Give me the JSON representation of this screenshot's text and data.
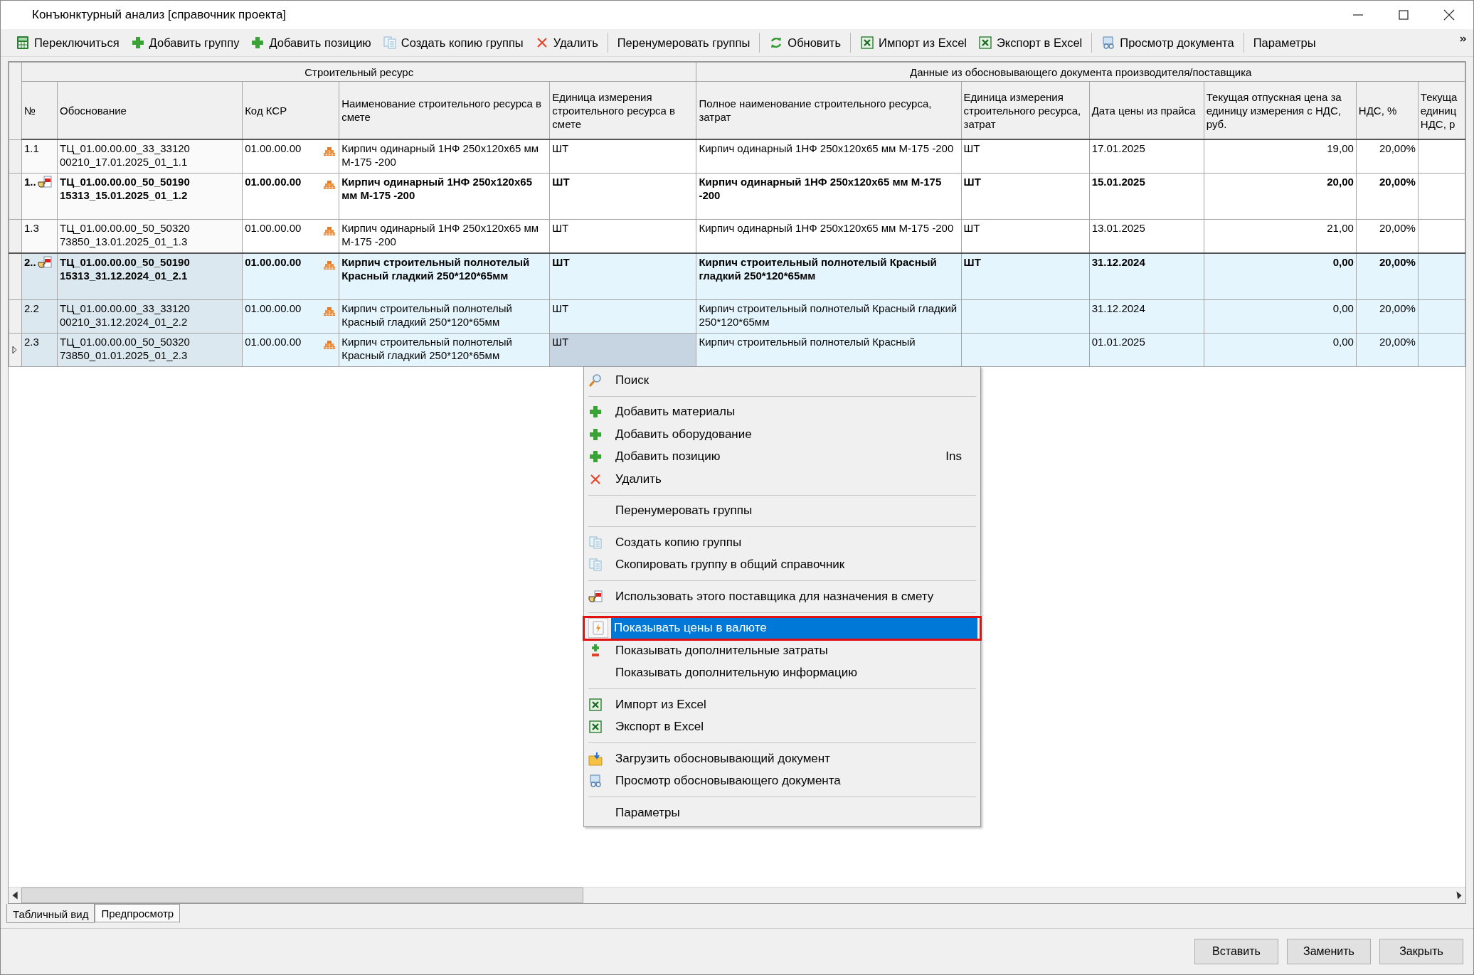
{
  "window": {
    "title": "Конъюнктурный анализ [справочник проекта]"
  },
  "toolbar": {
    "items": [
      {
        "label": "Переключиться"
      },
      {
        "label": "Добавить группу"
      },
      {
        "label": "Добавить позицию"
      },
      {
        "label": "Создать копию группы"
      },
      {
        "label": "Удалить"
      },
      {
        "label": "Перенумеровать группы"
      },
      {
        "label": "Обновить"
      },
      {
        "label": "Импорт из Excel"
      },
      {
        "label": "Экспорт в Excel"
      },
      {
        "label": "Просмотр документа"
      },
      {
        "label": "Параметры"
      }
    ]
  },
  "table": {
    "column_groups": [
      {
        "label": "Строительный ресурс"
      },
      {
        "label": "Данные из обосновывающего документа производителя/поставщика"
      }
    ],
    "columns": [
      {
        "label": "№"
      },
      {
        "label": "Обоснование"
      },
      {
        "label": "Код КСР"
      },
      {
        "label": "Наименование строительного ресурса в смете"
      },
      {
        "label": "Единица измерения строительного ресурса в смете"
      },
      {
        "label": "Полное наименование строительного ресурса, затрат"
      },
      {
        "label": "Единица измерения строительного ресурса, затрат"
      },
      {
        "label": "Дата цены из прайса"
      },
      {
        "label": "Текущая отпускная цена за единицу измерения с НДС, руб."
      },
      {
        "label": "НДС, %"
      },
      {
        "label": "Текуща единиц НДС, р"
      }
    ],
    "rows": [
      {
        "kind": "item",
        "selected": false,
        "current": false,
        "unit_focused": false,
        "cells": [
          "1.1",
          "ТЦ_01.00.00.00_33_33120 00210_17.01.2025_01_1.1",
          "01.00.00.00",
          "Кирпич одинарный 1НФ 250x120x65 мм М-175 -200",
          "ШТ",
          "Кирпич одинарный 1НФ 250x120x65 мм М-175 -200",
          "ШТ",
          "17.01.2025",
          "19,00",
          "20,00%"
        ]
      },
      {
        "kind": "group",
        "selected": false,
        "current": false,
        "unit_focused": false,
        "cells": [
          "1..",
          "ТЦ_01.00.00.00_50_50190 15313_15.01.2025_01_1.2",
          "01.00.00.00",
          "Кирпич одинарный 1НФ 250x120x65 мм М-175 -200",
          "ШТ",
          "Кирпич одинарный 1НФ 250x120x65 мм М-175 -200",
          "ШТ",
          "15.01.2025",
          "20,00",
          "20,00%"
        ]
      },
      {
        "kind": "item",
        "selected": false,
        "current": false,
        "unit_focused": false,
        "cells": [
          "1.3",
          "ТЦ_01.00.00.00_50_50320 73850_13.01.2025_01_1.3",
          "01.00.00.00",
          "Кирпич одинарный 1НФ 250x120x65 мм М-175 -200",
          "ШТ",
          "Кирпич одинарный 1НФ 250x120x65 мм М-175 -200",
          "ШТ",
          "13.01.2025",
          "21,00",
          "20,00%"
        ]
      },
      {
        "kind": "group",
        "selected": true,
        "current": false,
        "unit_focused": false,
        "cells": [
          "2..",
          "ТЦ_01.00.00.00_50_50190 15313_31.12.2024_01_2.1",
          "01.00.00.00",
          "Кирпич строительный полнотелый Красный гладкий 250*120*65мм",
          "ШТ",
          "Кирпич строительный полнотелый Красный гладкий 250*120*65мм",
          "ШТ",
          "31.12.2024",
          "0,00",
          "20,00%"
        ]
      },
      {
        "kind": "item",
        "selected": true,
        "current": false,
        "unit_focused": false,
        "cells": [
          "2.2",
          "ТЦ_01.00.00.00_33_33120 00210_31.12.2024_01_2.2",
          "01.00.00.00",
          "Кирпич строительный полнотелый Красный гладкий 250*120*65мм",
          "ШТ",
          "Кирпич строительный полнотелый Красный гладкий 250*120*65мм",
          "",
          "31.12.2024",
          "0,00",
          "20,00%"
        ]
      },
      {
        "kind": "item",
        "selected": true,
        "current": true,
        "unit_focused": true,
        "cells": [
          "2.3",
          "ТЦ_01.00.00.00_50_50320 73850_01.01.2025_01_2.3",
          "01.00.00.00",
          "Кирпич строительный полнотелый Красный гладкий 250*120*65мм",
          "ШТ",
          "Кирпич строительный полнотелый Красный",
          "",
          "01.01.2025",
          "0,00",
          "20,00%"
        ]
      }
    ]
  },
  "context_menu": {
    "items": [
      {
        "label": "Поиск",
        "selected": false,
        "highlighted": false
      },
      {
        "label": "Добавить материалы",
        "selected": false,
        "highlighted": false
      },
      {
        "label": "Добавить оборудование",
        "selected": false,
        "highlighted": false
      },
      {
        "label": "Добавить позицию",
        "shortcut": "Ins",
        "selected": false,
        "highlighted": false
      },
      {
        "label": "Удалить",
        "selected": false,
        "highlighted": false
      },
      {
        "label": "Перенумеровать группы",
        "selected": false,
        "highlighted": false
      },
      {
        "label": "Создать копию группы",
        "selected": false,
        "highlighted": false
      },
      {
        "label": "Скопировать группу в общий справочник",
        "selected": false,
        "highlighted": false
      },
      {
        "label": "Использовать этого поставщика для назначения в смету",
        "selected": false,
        "highlighted": false
      },
      {
        "label": "Показывать цены в валюте",
        "selected": true,
        "highlighted": true
      },
      {
        "label": "Показывать дополнительные затраты",
        "selected": false,
        "highlighted": false
      },
      {
        "label": "Показывать дополнительную информацию",
        "selected": false,
        "highlighted": false
      },
      {
        "label": "Импорт из Excel",
        "selected": false,
        "highlighted": false
      },
      {
        "label": "Экспорт в Excel",
        "selected": false,
        "highlighted": false
      },
      {
        "label": "Загрузить обосновывающий документ",
        "selected": false,
        "highlighted": false
      },
      {
        "label": "Просмотр обосновывающего документа",
        "selected": false,
        "highlighted": false
      },
      {
        "label": "Параметры",
        "selected": false,
        "highlighted": false
      }
    ]
  },
  "view_tabs": [
    {
      "label": "Табличный вид",
      "selected": true
    },
    {
      "label": "Предпросмотр",
      "selected": false
    }
  ],
  "buttons": [
    "Вставить",
    "Заменить",
    "Закрыть"
  ]
}
